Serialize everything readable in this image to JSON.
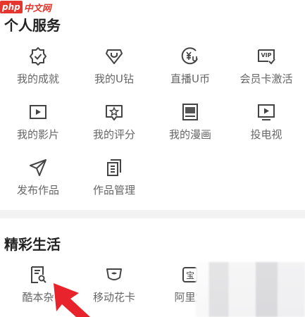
{
  "watermark": {
    "badge": "php",
    "text": "中文网"
  },
  "sections": {
    "personal_services": {
      "title": "个人服务",
      "items": [
        {
          "label": "我的成就",
          "icon": "achievement-badge-icon"
        },
        {
          "label": "我的U钻",
          "icon": "u-diamond-icon"
        },
        {
          "label": "直播U币",
          "icon": "live-ucoin-icon"
        },
        {
          "label": "会员卡激活",
          "icon": "vip-card-icon"
        },
        {
          "label": "我的影片",
          "icon": "video-play-icon"
        },
        {
          "label": "我的评分",
          "icon": "rating-star-icon"
        },
        {
          "label": "我的漫画",
          "icon": "comic-book-icon"
        },
        {
          "label": "投电视",
          "icon": "tv-cast-icon"
        },
        {
          "label": "发布作品",
          "icon": "paper-plane-icon"
        },
        {
          "label": "作品管理",
          "icon": "works-manage-icon"
        }
      ]
    },
    "lifestyle": {
      "title": "精彩生活",
      "items": [
        {
          "label": "酷本杂",
          "icon": "document-search-icon"
        },
        {
          "label": "移动花卡",
          "icon": "mobile-card-icon"
        },
        {
          "label": "阿里宝",
          "icon": "alibaba-treasure-icon"
        }
      ]
    }
  },
  "colors": {
    "icon": "#444444",
    "label": "#666666",
    "divider": "#f3f3f3",
    "arrow": "#e8232b"
  }
}
